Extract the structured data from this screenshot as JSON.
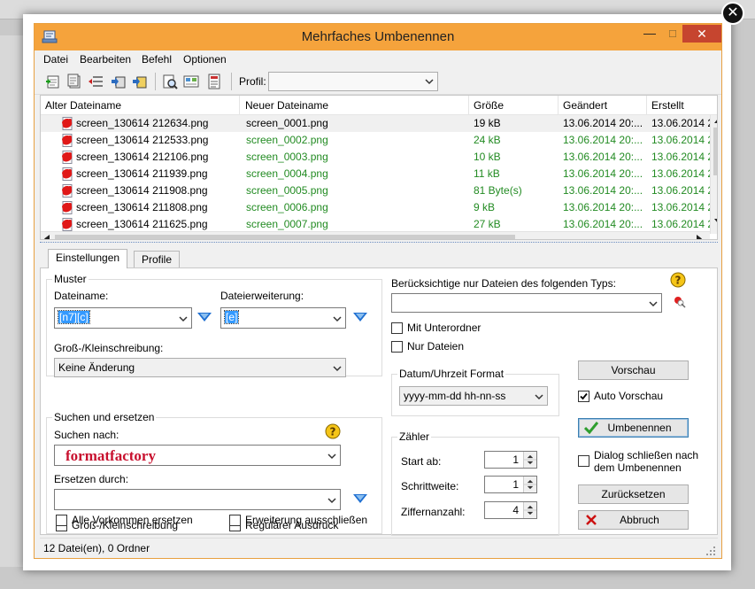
{
  "overlay": {
    "close_glyph": "✕"
  },
  "window": {
    "title": "Mehrfaches Umbenennen",
    "minimize": "—",
    "maximize": "☐",
    "close": "✕"
  },
  "menu": [
    "Datei",
    "Bearbeiten",
    "Befehl",
    "Optionen"
  ],
  "toolbar": {
    "profile_label": "Profil:",
    "profile_value": ""
  },
  "list": {
    "columns": [
      "Alter Dateiname",
      "Neuer Dateiname",
      "Größe",
      "Geändert",
      "Erstellt"
    ],
    "rows": [
      {
        "old": "screen_130614 212634.png",
        "new": "screen_0001.png",
        "size": "19 kB",
        "modified": "13.06.2014 20:...",
        "created": "13.06.2014 2",
        "changed": false
      },
      {
        "old": "screen_130614 212533.png",
        "new": "screen_0002.png",
        "size": "24 kB",
        "modified": "13.06.2014 20:...",
        "created": "13.06.2014 2",
        "changed": true
      },
      {
        "old": "screen_130614 212106.png",
        "new": "screen_0003.png",
        "size": "10 kB",
        "modified": "13.06.2014 20:...",
        "created": "13.06.2014 2",
        "changed": true
      },
      {
        "old": "screen_130614 211939.png",
        "new": "screen_0004.png",
        "size": "11 kB",
        "modified": "13.06.2014 20:...",
        "created": "13.06.2014 2",
        "changed": true
      },
      {
        "old": "screen_130614 211908.png",
        "new": "screen_0005.png",
        "size": "81 Byte(s)",
        "modified": "13.06.2014 20:...",
        "created": "13.06.2014 2",
        "changed": true
      },
      {
        "old": "screen_130614 211808.png",
        "new": "screen_0006.png",
        "size": "9 kB",
        "modified": "13.06.2014 20:...",
        "created": "13.06.2014 2",
        "changed": true
      },
      {
        "old": "screen_130614 211625.png",
        "new": "screen_0007.png",
        "size": "27 kB",
        "modified": "13.06.2014 20:...",
        "created": "13.06.2014 2",
        "changed": true
      }
    ]
  },
  "tabs": [
    "Einstellungen",
    "Profile"
  ],
  "muster": {
    "title": "Muster",
    "dateiname_label": "Dateiname:",
    "dateiname_value": "[n7][c]",
    "erweiterung_label": "Dateierweiterung:",
    "erweiterung_value": "[e]",
    "case_label": "Groß-/Kleinschreibung:",
    "case_value": "Keine Änderung"
  },
  "suchen": {
    "title": "Suchen und ersetzen",
    "search_label": "Suchen nach:",
    "search_value": "formatfactory",
    "replace_label": "Ersetzen durch:",
    "replace_value": "",
    "opt_case": "Groß-/Kleinschreibung",
    "opt_regex": "Regulärer Ausdruck",
    "opt_all": "Alle Vorkommen ersetzen",
    "opt_ext": "Erweiterung ausschließen"
  },
  "filter": {
    "label": "Berücksichtige nur Dateien des folgenden Typs:",
    "value": "",
    "subfolders": "Mit Unterordner",
    "files_only": "Nur Dateien"
  },
  "datetime": {
    "title": "Datum/Uhrzeit Format",
    "value": "yyyy-mm-dd hh-nn-ss"
  },
  "counter": {
    "title": "Zähler",
    "start_label": "Start ab:",
    "start_value": "1",
    "step_label": "Schrittweite:",
    "step_value": "1",
    "digits_label": "Ziffernanzahl:",
    "digits_value": "4"
  },
  "actions": {
    "preview": "Vorschau",
    "auto_preview": "Auto Vorschau",
    "rename": "Umbenennen",
    "close_after_line1": "Dialog schließen nach",
    "close_after_line2": "dem Umbenennen",
    "reset": "Zurücksetzen",
    "cancel": "Abbruch"
  },
  "status": {
    "text": "12 Datei(en), 0 Ordner"
  },
  "colors": {
    "title_bar": "#f5a33c",
    "close_button": "#c6452f",
    "new_name_green": "#228b22",
    "search_text_red": "#c8102e",
    "check_green": "#2e9e2e",
    "cancel_red": "#cc1111",
    "funnel_blue": "#1f6fd1"
  }
}
